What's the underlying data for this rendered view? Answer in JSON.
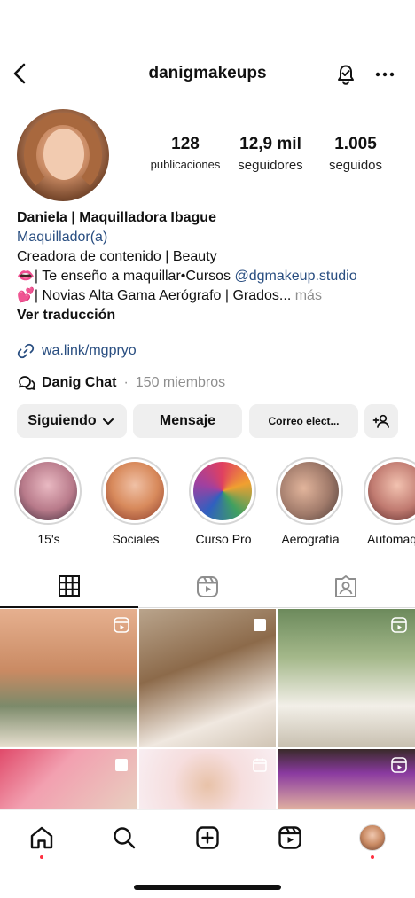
{
  "header": {
    "username": "danigmakeups"
  },
  "stats": [
    {
      "value": "128",
      "label": "publicaciones"
    },
    {
      "value": "12,9 mil",
      "label": "seguidores"
    },
    {
      "value": "1.005",
      "label": "seguidos"
    }
  ],
  "bio": {
    "name": "Daniela | Maquilladora Ibague",
    "category": "Maquillador(a)",
    "line1": "Creadora de contenido | Beauty",
    "line2_prefix": "👄| Te enseño a maquillar•Cursos ",
    "line2_link": "@dgmakeup.studio",
    "line3": "💕| Novias Alta Gama Aerógrafo | Grados...",
    "line3_more": " más",
    "translate": "Ver traducción"
  },
  "website": "wa.link/mgpryo",
  "chat": {
    "name": "Danig Chat",
    "separator": "·",
    "members": "150 miembros"
  },
  "buttons": {
    "following": "Siguiendo",
    "message": "Mensaje",
    "email": "Correo elect..."
  },
  "highlights": [
    {
      "label": "15's",
      "color": "#c58a9a"
    },
    {
      "label": "Sociales",
      "color": "#d88a5c"
    },
    {
      "label": "Curso Pro",
      "color": "#b85a6a"
    },
    {
      "label": "Aerografía",
      "color": "#a07a6a"
    },
    {
      "label": "Automaq",
      "color": "#c07a70"
    }
  ],
  "icons": {
    "back": "chevron-left-icon",
    "bell": "bell-check-icon",
    "more": "more-horizontal-icon",
    "link": "link-icon",
    "chat": "chat-bubbles-icon",
    "grid": "grid-icon",
    "reels": "reels-icon",
    "tagged": "tagged-person-icon",
    "home": "home-icon",
    "search": "search-icon",
    "create": "create-icon",
    "reels_nav": "reels-nav-icon",
    "profile": "profile-avatar"
  },
  "colors": {
    "link": "#284d80",
    "muted": "#8e8e8e",
    "button_bg": "#efefef",
    "notification": "#ff3040"
  }
}
